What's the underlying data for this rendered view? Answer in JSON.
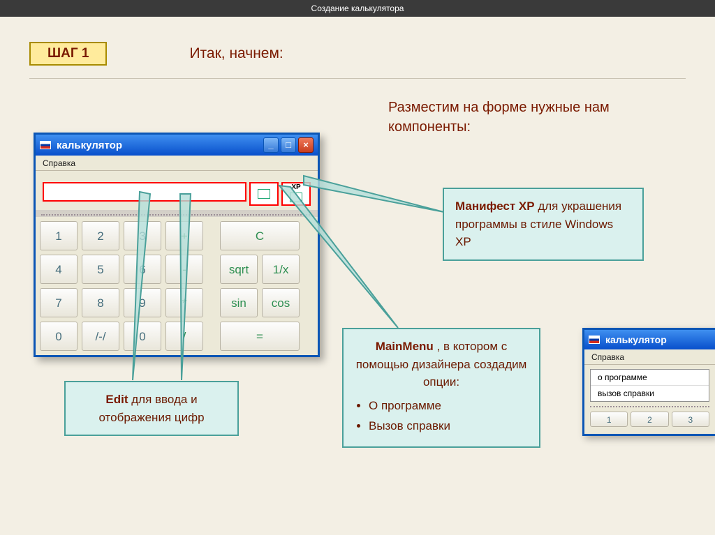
{
  "page": {
    "title": "Создание калькулятора",
    "step_label": "ШАГ 1",
    "intro": "Итак, начнем:",
    "description": "Разместим на форме нужные нам компоненты:"
  },
  "calc": {
    "title": "калькулятор",
    "menu": "Справка",
    "btn_min": "_",
    "btn_max": "□",
    "btn_close": "×",
    "keys": [
      [
        "1",
        "2",
        "3",
        "+",
        "",
        "C",
        ""
      ],
      [
        "4",
        "5",
        "6",
        "-",
        "",
        "sqrt",
        "1/x"
      ],
      [
        "7",
        "8",
        "9",
        "*",
        "",
        "sin",
        "cos"
      ],
      [
        "0",
        "/-/",
        "0",
        "/",
        "",
        "=",
        ""
      ]
    ]
  },
  "callouts": {
    "xp_strong": "Манифест ХР",
    "xp_rest": " для украшения программы в стиле Windows XP",
    "mm_strong": "MainMenu",
    "mm_rest": " , в котором с помощью дизайнера создадим опции:",
    "mm_items": [
      "О программе",
      "Вызов справки"
    ],
    "edit_strong": "Edit",
    "edit_rest": " для ввода и отображения цифр"
  },
  "calc2": {
    "title": "калькулятор",
    "menu": "Справка",
    "item1": "о программе",
    "item2": "вызов справки",
    "k1": "1",
    "k2": "2",
    "k3": "3"
  }
}
